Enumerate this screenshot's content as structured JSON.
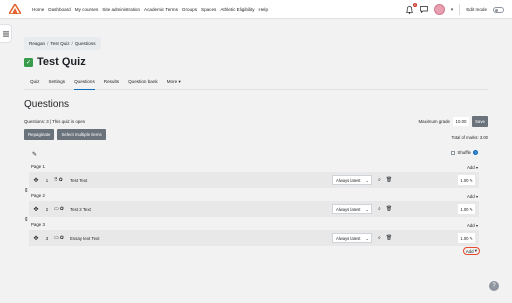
{
  "nav": {
    "links": [
      "Home",
      "Dashboard",
      "My courses",
      "Site administration",
      "Academic Terms",
      "Groups",
      "Spaces",
      "Athletic Eligibility",
      "Help"
    ],
    "notif_count": "4",
    "edit_mode_label": "Edit mode"
  },
  "breadcrumb": [
    "Reagan",
    "Test Quiz",
    "Questions"
  ],
  "quiz_title": "Test Quiz",
  "secnav": [
    "Quiz",
    "Settings",
    "Questions",
    "Results",
    "Question bank",
    "More"
  ],
  "heading": "Questions",
  "status": "Questions: 3 | This quiz is open",
  "buttons": {
    "repaginate": "Repaginate",
    "select_multiple": "Select multiple items",
    "save": "Save"
  },
  "max_grade": {
    "label": "Maximum grade",
    "value": "10.00"
  },
  "total_marks": "Total of marks: 3.00",
  "shuffle_label": "Shuffle",
  "add_label": "Add",
  "pages": [
    {
      "label": "Page 1",
      "question": {
        "num": "1",
        "name": "Test Text",
        "version": "Always latest",
        "mark": "1.00"
      }
    },
    {
      "label": "Page 2",
      "question": {
        "num": "2",
        "name": "Test 2 Text",
        "version": "Always latest",
        "mark": "1.00"
      }
    },
    {
      "label": "Page 3",
      "question": {
        "num": "3",
        "name": "Essay text Text",
        "version": "Always latest",
        "mark": "1.00"
      }
    }
  ]
}
